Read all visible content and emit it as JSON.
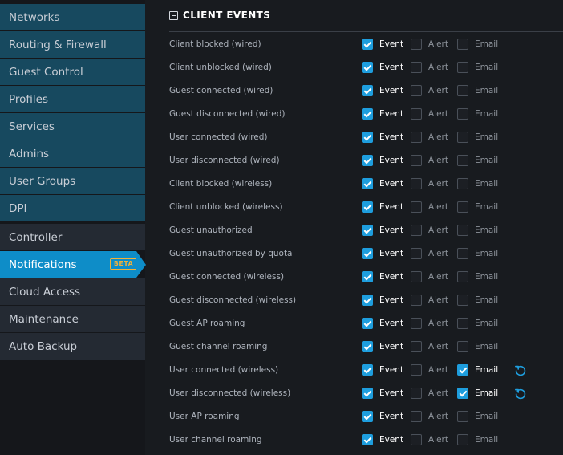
{
  "sidebar": {
    "items": [
      {
        "label": "Networks"
      },
      {
        "label": "Routing & Firewall"
      },
      {
        "label": "Guest Control"
      },
      {
        "label": "Profiles"
      },
      {
        "label": "Services"
      },
      {
        "label": "Admins"
      },
      {
        "label": "User Groups"
      },
      {
        "label": "DPI"
      },
      {
        "label": "Controller"
      },
      {
        "label": "Notifications",
        "badge": "BETA"
      },
      {
        "label": "Cloud Access"
      },
      {
        "label": "Maintenance"
      },
      {
        "label": "Auto Backup"
      }
    ],
    "active": "Notifications"
  },
  "section": {
    "title": "CLIENT EVENTS",
    "option_labels": {
      "event": "Event",
      "alert": "Alert",
      "email": "Email"
    },
    "rows": [
      {
        "label": "Client blocked (wired)",
        "event": true,
        "alert": false,
        "email": false
      },
      {
        "label": "Client unblocked (wired)",
        "event": true,
        "alert": false,
        "email": false
      },
      {
        "label": "Guest connected (wired)",
        "event": true,
        "alert": false,
        "email": false
      },
      {
        "label": "Guest disconnected (wired)",
        "event": true,
        "alert": false,
        "email": false
      },
      {
        "label": "User connected (wired)",
        "event": true,
        "alert": false,
        "email": false
      },
      {
        "label": "User disconnected (wired)",
        "event": true,
        "alert": false,
        "email": false
      },
      {
        "label": "Client blocked (wireless)",
        "event": true,
        "alert": false,
        "email": false
      },
      {
        "label": "Client unblocked (wireless)",
        "event": true,
        "alert": false,
        "email": false
      },
      {
        "label": "Guest unauthorized",
        "event": true,
        "alert": false,
        "email": false
      },
      {
        "label": "Guest unauthorized by quota",
        "event": true,
        "alert": false,
        "email": false
      },
      {
        "label": "Guest connected (wireless)",
        "event": true,
        "alert": false,
        "email": false
      },
      {
        "label": "Guest disconnected (wireless)",
        "event": true,
        "alert": false,
        "email": false
      },
      {
        "label": "Guest AP roaming",
        "event": true,
        "alert": false,
        "email": false
      },
      {
        "label": "Guest channel roaming",
        "event": true,
        "alert": false,
        "email": false
      },
      {
        "label": "User connected (wireless)",
        "event": true,
        "alert": false,
        "email": true,
        "reset": true
      },
      {
        "label": "User disconnected (wireless)",
        "event": true,
        "alert": false,
        "email": true,
        "reset": true
      },
      {
        "label": "User AP roaming",
        "event": true,
        "alert": false,
        "email": false
      },
      {
        "label": "User channel roaming",
        "event": true,
        "alert": false,
        "email": false
      }
    ]
  },
  "colors": {
    "accent": "#1e9ede",
    "active_nav": "#0e8dc8",
    "beta_badge": "#f2b23a"
  },
  "icons": {
    "collapse": "minus-square-icon",
    "reset": "reset-icon",
    "check": "check-icon"
  }
}
